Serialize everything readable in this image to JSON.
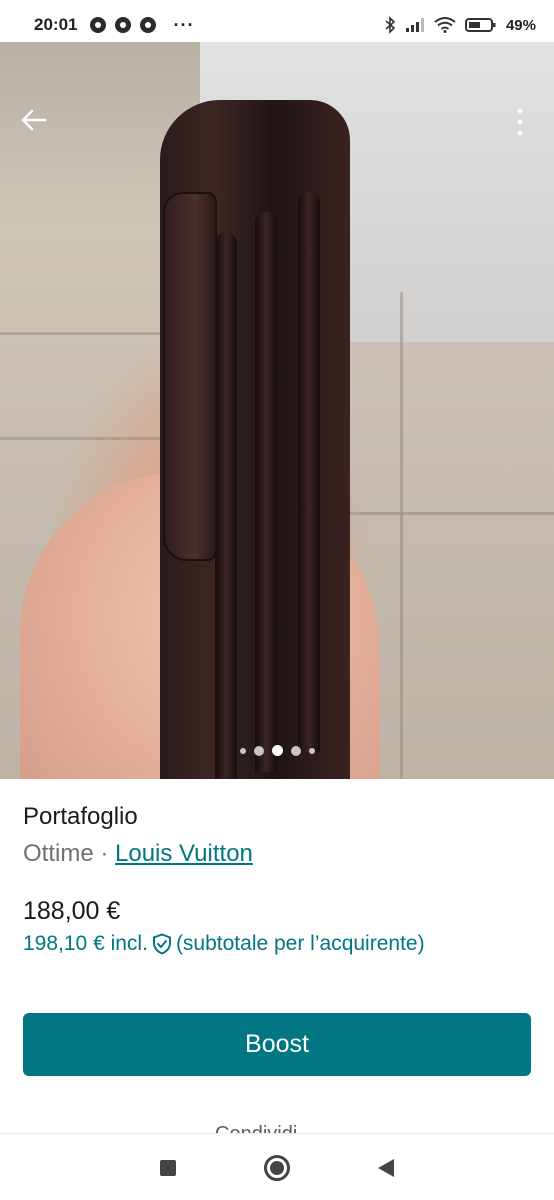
{
  "status_bar": {
    "time": "20:01",
    "more": "···",
    "battery": "49%"
  },
  "listing": {
    "title": "Portafoglio",
    "condition": "Ottime",
    "separator": " · ",
    "brand": "Louis Vuitton",
    "price": "188,00 €",
    "price_incl": "198,10 € incl.",
    "price_incl_note": "(subtotale per l’acquirente)"
  },
  "carousel": {
    "total_images": 5,
    "active_index": 2
  },
  "actions": {
    "boost_label": "Boost",
    "partial_text": "Condividi"
  },
  "colors": {
    "accent": "#007782"
  },
  "icons": {
    "back": "back-arrow-icon",
    "menu": "more-vertical-icon",
    "shield": "shield-check-icon"
  }
}
